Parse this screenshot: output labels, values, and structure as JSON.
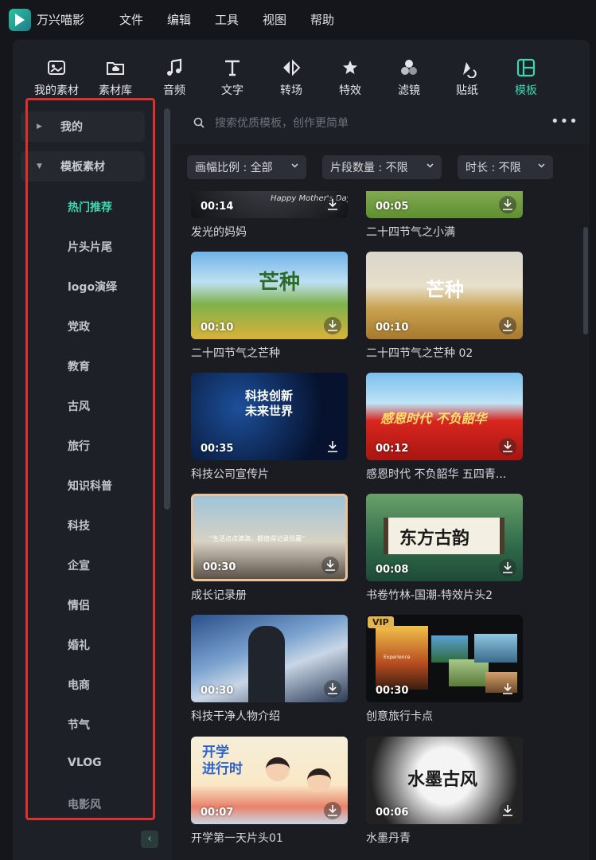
{
  "app": {
    "title": "万兴喵影"
  },
  "menu": [
    "文件",
    "编辑",
    "工具",
    "视图",
    "帮助"
  ],
  "toolbar": [
    {
      "label": "我的素材",
      "icon": "my-media-icon"
    },
    {
      "label": "素材库",
      "icon": "media-library-icon"
    },
    {
      "label": "音频",
      "icon": "music-note-icon"
    },
    {
      "label": "文字",
      "icon": "text-icon"
    },
    {
      "label": "转场",
      "icon": "transition-icon"
    },
    {
      "label": "特效",
      "icon": "effects-icon"
    },
    {
      "label": "滤镜",
      "icon": "filters-icon"
    },
    {
      "label": "贴纸",
      "icon": "sticker-icon"
    },
    {
      "label": "模板",
      "icon": "template-icon",
      "active": true
    }
  ],
  "sidebar": {
    "mine": "我的",
    "templates": "模板素材",
    "items": [
      "热门推荐",
      "片头片尾",
      "logo演绎",
      "党政",
      "教育",
      "古风",
      "旅行",
      "知识科普",
      "科技",
      "企宣",
      "情侣",
      "婚礼",
      "电商",
      "节气",
      "VLOG",
      "电影风"
    ]
  },
  "search": {
    "placeholder": "搜索优质模板，创作更简单"
  },
  "filters": [
    {
      "label": "画幅比例 : 全部"
    },
    {
      "label": "片段数量 : 不限"
    },
    {
      "label": "时长 : 不限"
    }
  ],
  "cards": [
    {
      "duration": "00:14",
      "title": "发光的妈妈",
      "overlay": "Happy Mother's Day"
    },
    {
      "duration": "00:05",
      "title": "二十四节气之小满"
    },
    {
      "duration": "00:10",
      "title": "二十四节气之芒种",
      "overlay": "芒种"
    },
    {
      "duration": "00:10",
      "title": "二十四节气之芒种 02",
      "overlay": "芒种"
    },
    {
      "duration": "00:35",
      "title": "科技公司宣传片",
      "overlay": "科技创新\n未来世界"
    },
    {
      "duration": "00:12",
      "title": "感恩时代 不负韶华 五四青...",
      "overlay": "感恩时代  不负韶华"
    },
    {
      "duration": "00:30",
      "title": "成长记录册",
      "overlay": "“生活点点滴滴，都值得记录珍藏”"
    },
    {
      "duration": "00:08",
      "title": "书卷竹林-国潮-特效片头2",
      "overlay": "东方古韵"
    },
    {
      "duration": "00:30",
      "title": "科技干净人物介绍"
    },
    {
      "duration": "00:30",
      "title": "创意旅行卡点",
      "badge": "VIP",
      "overlay": "Experience"
    },
    {
      "duration": "00:07",
      "title": "开学第一天片头01",
      "overlay": "开学\n进行时"
    },
    {
      "duration": "00:06",
      "title": "水墨丹青",
      "overlay": "水墨古风"
    }
  ]
}
